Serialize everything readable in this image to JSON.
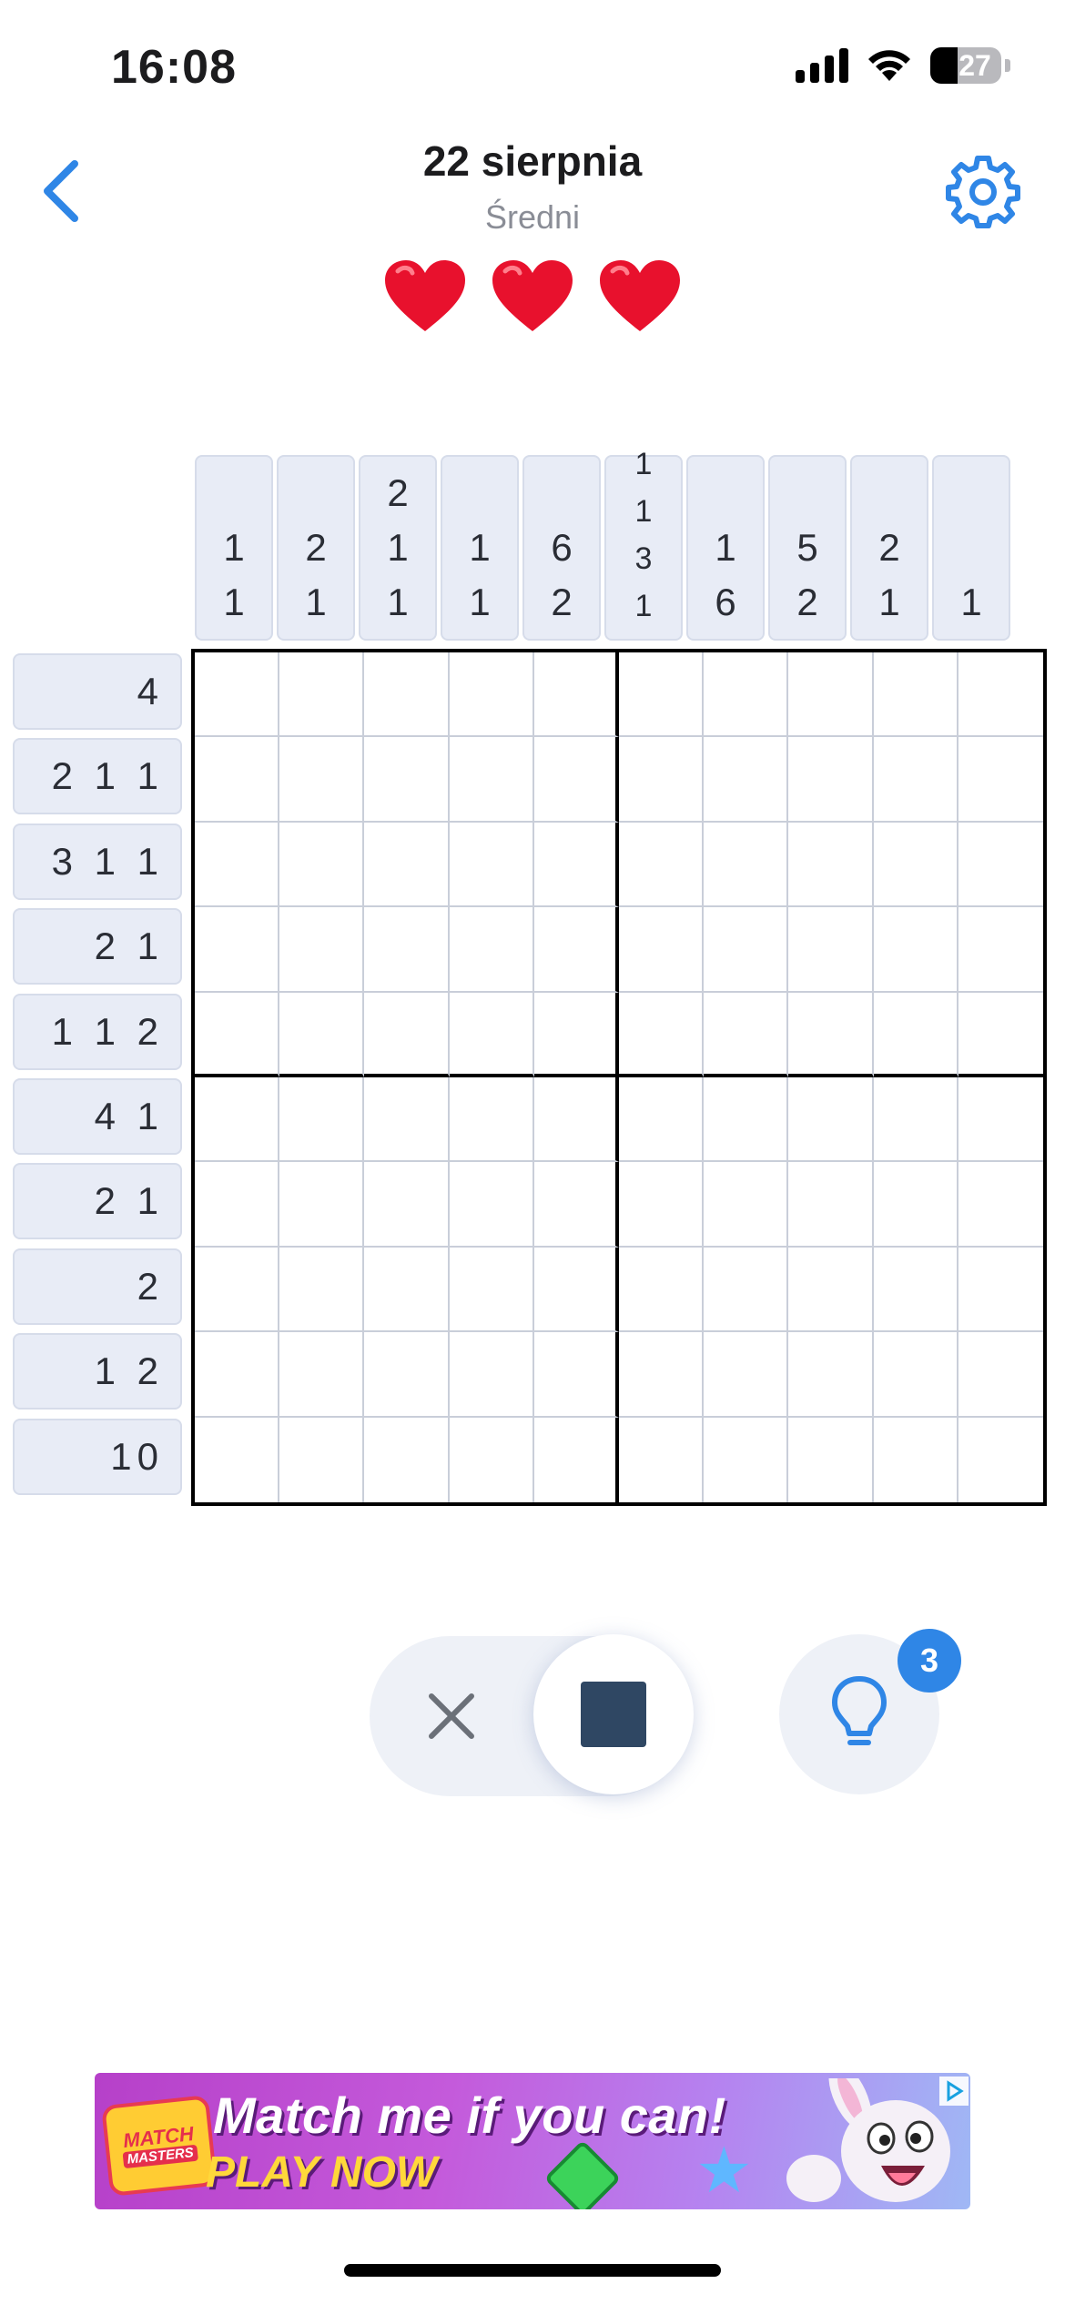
{
  "status_bar": {
    "time": "16:08",
    "battery": "27"
  },
  "header": {
    "title": "22 sierpnia",
    "difficulty": "Średni",
    "lives": 3
  },
  "puzzle": {
    "column_clues": [
      [
        "1",
        "1"
      ],
      [
        "2",
        "1"
      ],
      [
        "2",
        "1",
        "1"
      ],
      [
        "1",
        "1"
      ],
      [
        "6",
        "2"
      ],
      [
        "1",
        "1",
        "3",
        "1"
      ],
      [
        "1",
        "6"
      ],
      [
        "5",
        "2"
      ],
      [
        "2",
        "1"
      ],
      [
        "1"
      ]
    ],
    "row_clues": [
      "4",
      "2 1 1",
      "3 1 1",
      "2 1",
      "1 1 2",
      "4 1",
      "2 1",
      "2",
      "1 2",
      "10"
    ],
    "size": 10
  },
  "controls": {
    "mode": "fill",
    "hint_count": "3"
  },
  "ad": {
    "logo_line1": "MATCH",
    "logo_line2": "MASTERS",
    "headline": "Match me if you can!",
    "cta": "PLAY NOW"
  },
  "colors": {
    "accent": "#2f86e6",
    "heart": "#e8112d",
    "clue_bg": "#e8ecf6",
    "fill_square": "#2f4763"
  },
  "icons": [
    "back-chevron-icon",
    "settings-gear-icon",
    "heart-icon",
    "cross-icon",
    "fill-square-icon",
    "lightbulb-icon",
    "ad-choices-icon"
  ]
}
